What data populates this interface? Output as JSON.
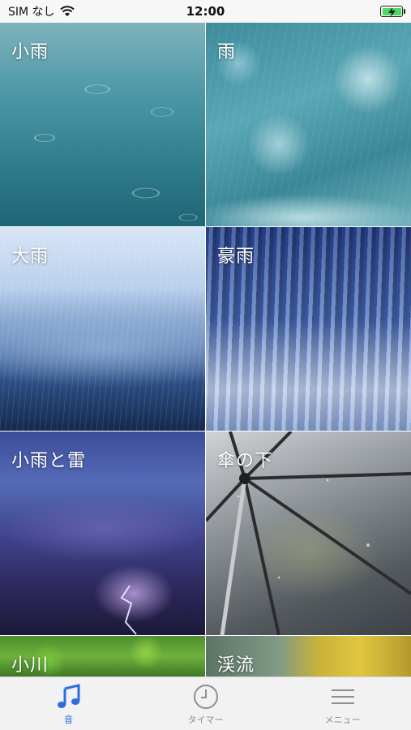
{
  "status_bar": {
    "carrier": "SIM なし",
    "time": "12:00"
  },
  "tiles": [
    {
      "label": "小雨"
    },
    {
      "label": "雨"
    },
    {
      "label": "大雨"
    },
    {
      "label": "豪雨"
    },
    {
      "label": "小雨と雷"
    },
    {
      "label": "傘の下"
    },
    {
      "label": "小川"
    },
    {
      "label": "渓流"
    }
  ],
  "tab_bar": {
    "tabs": [
      {
        "label": "音",
        "icon": "music-note-icon",
        "active": true
      },
      {
        "label": "タイマー",
        "icon": "clock-icon",
        "active": false
      },
      {
        "label": "メニュー",
        "icon": "menu-icon",
        "active": false
      }
    ]
  },
  "colors": {
    "accent": "#2a6de0",
    "inactive": "#8e8e93",
    "battery": "#4cd964"
  }
}
